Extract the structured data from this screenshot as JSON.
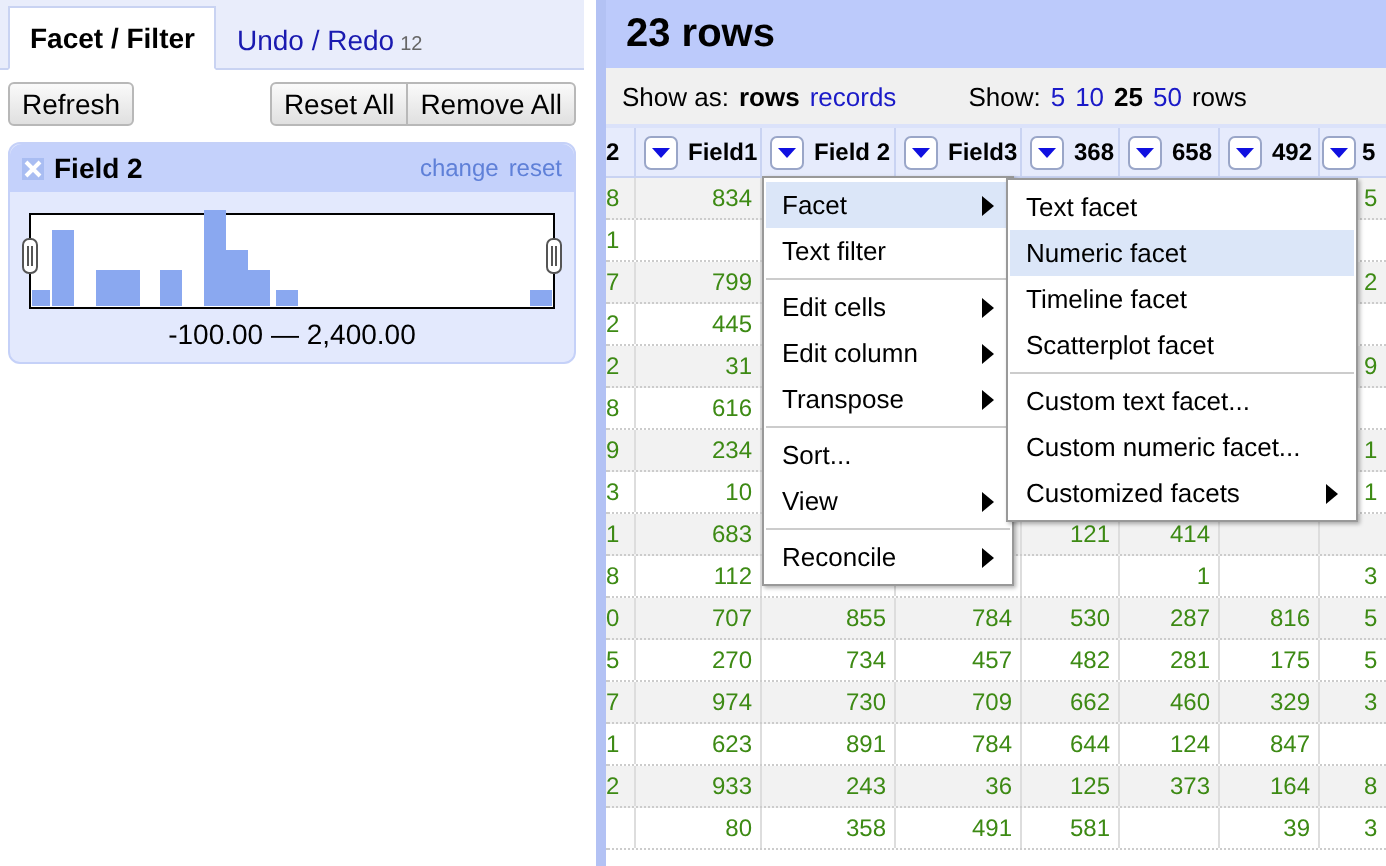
{
  "left_panel": {
    "tabs": [
      {
        "label": "Facet / Filter",
        "selected": true
      },
      {
        "label": "Undo / Redo",
        "count": "12",
        "selected": false
      }
    ],
    "buttons": {
      "refresh": "Refresh",
      "reset_all": "Reset All",
      "remove_all": "Remove All"
    },
    "facet": {
      "title": "Field 2",
      "links": [
        "change",
        "reset"
      ],
      "range": "-100.00 — 2,400.00"
    }
  },
  "header": {
    "title": "23 rows"
  },
  "view_bar": {
    "show_as_label": "Show as:",
    "modes": [
      {
        "label": "rows",
        "selected": true
      },
      {
        "label": "records",
        "selected": false
      }
    ],
    "show_label": "Show:",
    "page_sizes": [
      {
        "label": "5",
        "selected": false
      },
      {
        "label": "10",
        "selected": false
      },
      {
        "label": "25",
        "selected": true
      },
      {
        "label": "50",
        "selected": false
      }
    ],
    "unit": "rows"
  },
  "table": {
    "columns": [
      {
        "name": "2",
        "menu": false
      },
      {
        "name": "Field1",
        "menu": true
      },
      {
        "name": "Field 2",
        "menu": true
      },
      {
        "name": "Field3",
        "menu": true
      },
      {
        "name": "368",
        "menu": true
      },
      {
        "name": "658",
        "menu": true
      },
      {
        "name": "492",
        "menu": true
      },
      {
        "name": "5",
        "menu": true
      }
    ],
    "rows": [
      {
        "cells": [
          "8",
          "834",
          null,
          null,
          null,
          null,
          null,
          "5"
        ]
      },
      {
        "cells": [
          "1",
          null,
          null,
          null,
          null,
          null,
          null,
          null
        ]
      },
      {
        "cells": [
          "7",
          "799",
          null,
          null,
          null,
          null,
          null,
          "2"
        ]
      },
      {
        "cells": [
          "2",
          "445",
          null,
          null,
          null,
          null,
          null,
          null
        ]
      },
      {
        "cells": [
          "2",
          "31",
          null,
          null,
          null,
          null,
          null,
          "9"
        ]
      },
      {
        "cells": [
          "8",
          "616",
          null,
          null,
          null,
          null,
          null,
          null
        ]
      },
      {
        "cells": [
          "9",
          "234",
          null,
          null,
          null,
          null,
          null,
          "1"
        ]
      },
      {
        "cells": [
          "3",
          "10",
          null,
          null,
          null,
          null,
          null,
          "1"
        ]
      },
      {
        "cells": [
          "1",
          "683",
          null,
          null,
          "121",
          "414",
          null,
          null
        ]
      },
      {
        "cells": [
          "8",
          "112",
          null,
          null,
          null,
          "1",
          null,
          "3"
        ]
      },
      {
        "cells": [
          "0",
          "707",
          "855",
          "784",
          "530",
          "287",
          "816",
          "5"
        ]
      },
      {
        "cells": [
          "5",
          "270",
          "734",
          "457",
          "482",
          "281",
          "175",
          "5"
        ]
      },
      {
        "cells": [
          "7",
          "974",
          "730",
          "709",
          "662",
          "460",
          "329",
          "3"
        ]
      },
      {
        "cells": [
          "1",
          "623",
          "891",
          "784",
          "644",
          "124",
          "847",
          null
        ]
      },
      {
        "cells": [
          "2",
          "933",
          "243",
          "36",
          "125",
          "373",
          "164",
          "8"
        ]
      },
      {
        "cells": [
          null,
          "80",
          "358",
          "491",
          "581",
          null,
          "39",
          "3"
        ]
      }
    ]
  },
  "column_menu": {
    "groups": [
      [
        {
          "label": "Facet",
          "submenu": true,
          "selected": true
        },
        {
          "label": "Text filter",
          "submenu": false,
          "selected": false
        }
      ],
      [
        {
          "label": "Edit cells",
          "submenu": true,
          "selected": false
        },
        {
          "label": "Edit column",
          "submenu": true,
          "selected": false
        },
        {
          "label": "Transpose",
          "submenu": true,
          "selected": false
        }
      ],
      [
        {
          "label": "Sort...",
          "submenu": false,
          "selected": false
        },
        {
          "label": "View",
          "submenu": true,
          "selected": false
        }
      ],
      [
        {
          "label": "Reconcile",
          "submenu": true,
          "selected": false
        }
      ]
    ]
  },
  "facet_submenu": {
    "groups": [
      [
        {
          "label": "Text facet",
          "submenu": false,
          "selected": false
        },
        {
          "label": "Numeric facet",
          "submenu": false,
          "selected": true
        },
        {
          "label": "Timeline facet",
          "submenu": false,
          "selected": false
        },
        {
          "label": "Scatterplot facet",
          "submenu": false,
          "selected": false
        }
      ],
      [
        {
          "label": "Custom text facet...",
          "submenu": false,
          "selected": false
        },
        {
          "label": "Custom numeric facet...",
          "submenu": false,
          "selected": false
        },
        {
          "label": "Customized facets",
          "submenu": true,
          "selected": false
        }
      ]
    ]
  }
}
